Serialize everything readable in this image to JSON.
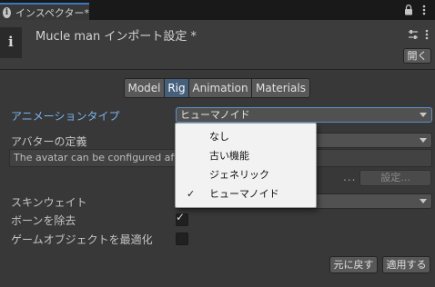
{
  "tab": {
    "title": "インスペクター*",
    "info_glyph": "i"
  },
  "header": {
    "asset_icon_glyph": "i",
    "title": "Mucle man インポート設定 *",
    "open_label": "開く"
  },
  "tabs": [
    "Model",
    "Rig",
    "Animation",
    "Materials"
  ],
  "active_tab": "Rig",
  "rig": {
    "animation_type_label": "アニメーションタイプ",
    "animation_type_value": "ヒューマノイド",
    "avatar_definition_label": "アバターの定義",
    "help_text": "The avatar can be configured after se",
    "dots": "...",
    "configure_label": "設定...",
    "skin_weights_label": "スキンウェイト",
    "strip_bones_label": "ボーンを除去",
    "strip_bones_checked": true,
    "optimize_label": "ゲームオブジェクトを最適化",
    "optimize_checked": false
  },
  "buttons": {
    "revert": "元に戻す",
    "apply": "適用する"
  },
  "dropdown": {
    "items": [
      {
        "label": "なし",
        "checked": false
      },
      {
        "label": "古い機能",
        "checked": false
      },
      {
        "label": "ジェネリック",
        "checked": false
      },
      {
        "label": "ヒューマノイド",
        "checked": true
      }
    ],
    "check_glyph": "✓"
  },
  "colors": {
    "panel_bg": "#383838",
    "accent_blue": "#3a79bb",
    "label_highlight": "#7ab3ee",
    "active_tab": "#46607c",
    "menu_bg": "#f2f2f2"
  },
  "icons": {
    "tab_lock": "lock-icon",
    "tab_menu": "kebab-menu-icon",
    "preset": "preset-icon",
    "header_menu": "kebab-menu-icon",
    "check": "checkmark-icon",
    "dropdown_arrow": "chevron-down-icon"
  }
}
